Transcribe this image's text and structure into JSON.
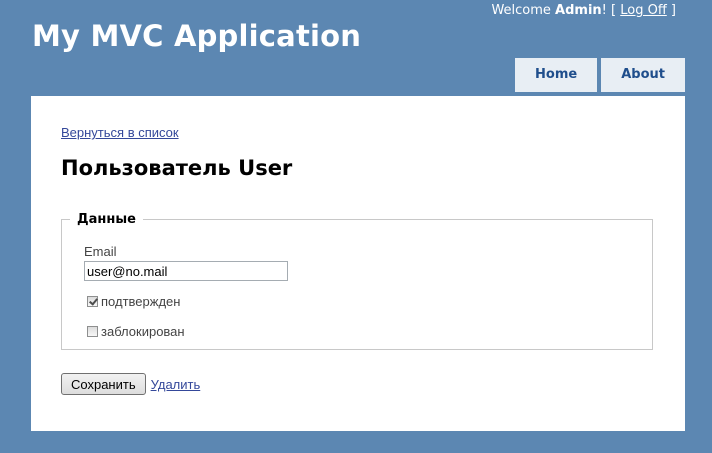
{
  "header": {
    "title": "My MVC Application",
    "welcome_prefix": "Welcome ",
    "username": "Admin",
    "welcome_suffix": "! [ ",
    "logoff_label": "Log Off",
    "bracket_close": " ]"
  },
  "menu": {
    "items": [
      {
        "label": "Home"
      },
      {
        "label": "About"
      }
    ]
  },
  "main": {
    "back_link": "Вернуться в список",
    "heading": "Пользователь User",
    "fieldset_legend": "Данные",
    "email_label": "Email",
    "email_value": "user@no.mail",
    "confirmed_label": "подтвержден",
    "confirmed_checked": true,
    "blocked_label": "заблокирован",
    "blocked_checked": false,
    "save_label": "Сохранить",
    "delete_label": "Удалить"
  },
  "colors": {
    "background": "#5c87b2",
    "menu_tab": "#e8eef4",
    "link": "#34489a"
  }
}
